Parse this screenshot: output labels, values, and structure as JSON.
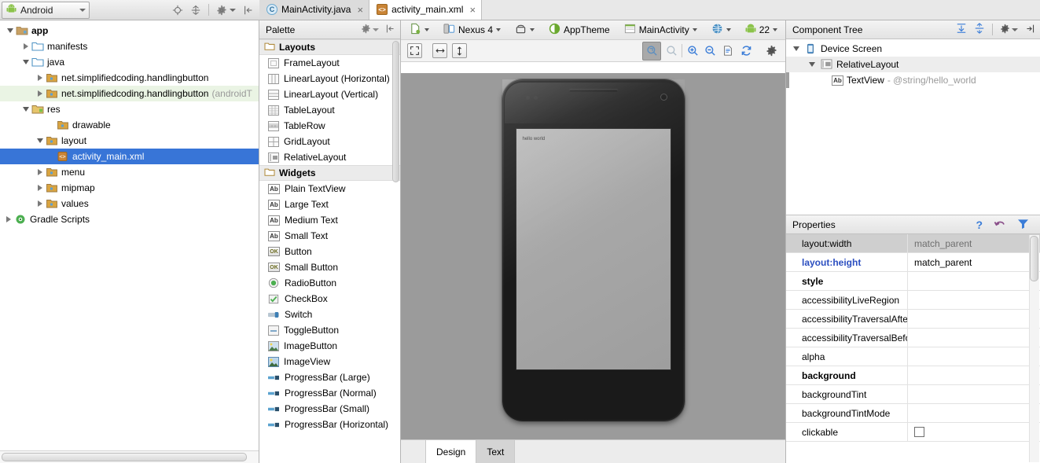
{
  "window": {
    "project_selector": {
      "label": "Android",
      "icon": "android-robot-icon"
    }
  },
  "project_toolbar": {
    "icons": [
      {
        "name": "locate-icon",
        "label": "Select Opened File"
      },
      {
        "name": "collapse-all-icon",
        "label": "Collapse All"
      },
      {
        "name": "settings-gear-icon",
        "label": "Settings"
      },
      {
        "name": "hide-panel-icon",
        "label": "Hide"
      }
    ]
  },
  "editor_tabs": [
    {
      "label": "MainActivity.java",
      "icon": "java-class-icon",
      "icon_letter": "C",
      "active": false,
      "close": "×"
    },
    {
      "label": "activity_main.xml",
      "icon": "xml-layout-icon",
      "icon_letter": "<>",
      "active": true,
      "close": "×"
    }
  ],
  "project_tree": {
    "items": [
      {
        "label": "app",
        "indent": 0,
        "state": "open",
        "icon": "module-folder-icon",
        "bold": true,
        "selected": false,
        "highlight": false,
        "sub": ""
      },
      {
        "label": "manifests",
        "indent": 1,
        "state": "closed",
        "icon": "folder-icon",
        "bold": false,
        "selected": false,
        "highlight": false,
        "sub": ""
      },
      {
        "label": "java",
        "indent": 1,
        "state": "open",
        "icon": "folder-icon",
        "bold": false,
        "selected": false,
        "highlight": false,
        "sub": ""
      },
      {
        "label": "net.simplifiedcoding.handlingbutton",
        "indent": 2,
        "state": "closed",
        "icon": "package-icon",
        "bold": false,
        "selected": false,
        "highlight": false,
        "sub": ""
      },
      {
        "label": "net.simplifiedcoding.handlingbutton",
        "indent": 2,
        "state": "closed",
        "icon": "package-icon",
        "bold": false,
        "selected": false,
        "highlight": true,
        "sub": "(androidT"
      },
      {
        "label": "res",
        "indent": 1,
        "state": "open",
        "icon": "res-folder-icon",
        "bold": false,
        "selected": false,
        "highlight": false,
        "sub": ""
      },
      {
        "label": "drawable",
        "indent": 2,
        "state": "none",
        "icon": "res-sub-folder-icon",
        "bold": false,
        "selected": false,
        "highlight": false,
        "sub": ""
      },
      {
        "label": "layout",
        "indent": 2,
        "state": "open",
        "icon": "res-sub-folder-icon",
        "bold": false,
        "selected": false,
        "highlight": false,
        "sub": ""
      },
      {
        "label": "activity_main.xml",
        "indent": 3,
        "state": "none",
        "icon": "xml-layout-icon",
        "bold": false,
        "selected": true,
        "highlight": false,
        "sub": ""
      },
      {
        "label": "menu",
        "indent": 2,
        "state": "closed",
        "icon": "res-sub-folder-icon",
        "bold": false,
        "selected": false,
        "highlight": false,
        "sub": ""
      },
      {
        "label": "mipmap",
        "indent": 2,
        "state": "closed",
        "icon": "res-sub-folder-icon",
        "bold": false,
        "selected": false,
        "highlight": false,
        "sub": ""
      },
      {
        "label": "values",
        "indent": 2,
        "state": "closed",
        "icon": "res-sub-folder-icon",
        "bold": false,
        "selected": false,
        "highlight": false,
        "sub": ""
      },
      {
        "label": "Gradle Scripts",
        "indent": 0,
        "state": "closed",
        "icon": "gradle-icon",
        "bold": false,
        "selected": false,
        "highlight": false,
        "sub": ""
      }
    ]
  },
  "palette": {
    "title": "Palette",
    "groups": [
      {
        "name": "Layouts",
        "items": [
          {
            "label": "FrameLayout",
            "icon": "frame-layout-icon"
          },
          {
            "label": "LinearLayout (Horizontal)",
            "icon": "linear-horizontal-icon"
          },
          {
            "label": "LinearLayout (Vertical)",
            "icon": "linear-vertical-icon"
          },
          {
            "label": "TableLayout",
            "icon": "table-layout-icon"
          },
          {
            "label": "TableRow",
            "icon": "table-row-icon"
          },
          {
            "label": "GridLayout",
            "icon": "grid-layout-icon"
          },
          {
            "label": "RelativeLayout",
            "icon": "relative-layout-icon"
          }
        ]
      },
      {
        "name": "Widgets",
        "items": [
          {
            "label": "Plain TextView",
            "icon": "text-ab-icon"
          },
          {
            "label": "Large Text",
            "icon": "text-ab-icon"
          },
          {
            "label": "Medium Text",
            "icon": "text-ab-icon"
          },
          {
            "label": "Small Text",
            "icon": "text-ab-icon"
          },
          {
            "label": "Button",
            "icon": "button-ok-icon"
          },
          {
            "label": "Small Button",
            "icon": "button-ok-icon"
          },
          {
            "label": "RadioButton",
            "icon": "radio-button-icon"
          },
          {
            "label": "CheckBox",
            "icon": "checkbox-icon"
          },
          {
            "label": "Switch",
            "icon": "switch-icon"
          },
          {
            "label": "ToggleButton",
            "icon": "toggle-button-icon"
          },
          {
            "label": "ImageButton",
            "icon": "image-button-icon"
          },
          {
            "label": "ImageView",
            "icon": "image-view-icon"
          },
          {
            "label": "ProgressBar (Large)",
            "icon": "progressbar-icon"
          },
          {
            "label": "ProgressBar (Normal)",
            "icon": "progressbar-icon"
          },
          {
            "label": "ProgressBar (Small)",
            "icon": "progressbar-icon"
          },
          {
            "label": "ProgressBar (Horizontal)",
            "icon": "progressbar-icon"
          }
        ]
      }
    ]
  },
  "design_toolbar": {
    "row1": [
      {
        "name": "device-config-button",
        "label": "",
        "icon": "layout-file-icon",
        "caret": true
      },
      {
        "name": "device-button",
        "label": "Nexus 4",
        "icon": "device-icon",
        "caret": true
      },
      {
        "name": "orientation-button",
        "label": "",
        "icon": "rotate-icon",
        "caret": true
      },
      {
        "name": "theme-button",
        "label": "AppTheme",
        "icon": "theme-contrast-icon",
        "caret": false
      },
      {
        "name": "activity-button",
        "label": "MainActivity",
        "icon": "activity-icon",
        "caret": true
      },
      {
        "name": "locale-button",
        "label": "",
        "icon": "globe-icon",
        "caret": true
      },
      {
        "name": "api-level-button",
        "label": "22",
        "icon": "android-robot-icon",
        "caret": true
      }
    ],
    "row2_left": [
      {
        "name": "zoom-fit-button",
        "icon": "fit-screen-icon",
        "caret": true
      },
      {
        "name": "width-constraint-button",
        "icon": "horizontal-arrows-icon",
        "caret": false
      },
      {
        "name": "height-constraint-button",
        "icon": "vertical-arrows-icon",
        "caret": false
      }
    ],
    "row2_right": [
      {
        "name": "zoom-to-fit-button",
        "icon": "zoom-fit-icon",
        "pressed": true
      },
      {
        "name": "zoom-actual-size-button",
        "icon": "zoom-1-1-icon",
        "pressed": false
      },
      {
        "name": "zoom-in-button",
        "icon": "zoom-in-icon",
        "pressed": false
      },
      {
        "name": "zoom-out-button",
        "icon": "zoom-out-icon",
        "pressed": false
      },
      {
        "name": "render-log-button",
        "icon": "document-icon",
        "pressed": false
      },
      {
        "name": "refresh-button",
        "icon": "refresh-icon",
        "pressed": false
      },
      {
        "name": "design-settings-button",
        "icon": "gear-icon",
        "pressed": false
      }
    ]
  },
  "preview": {
    "device_name": "Nexus 4",
    "screen_text": "hello world"
  },
  "editor_bottom_tabs": [
    {
      "label": "Design",
      "active": true
    },
    {
      "label": "Text",
      "active": false
    }
  ],
  "component_tree": {
    "title": "Component Tree",
    "toolbar_icons": [
      {
        "name": "expand-all-icon"
      },
      {
        "name": "collapse-all-icon"
      },
      {
        "name": "settings-gear-icon"
      },
      {
        "name": "hide-panel-icon"
      }
    ],
    "nodes": [
      {
        "label": "Device Screen",
        "sub": "",
        "indent": 0,
        "state": "open",
        "icon": "device-screen-icon",
        "highlight": false
      },
      {
        "label": "RelativeLayout",
        "sub": "",
        "indent": 1,
        "state": "open",
        "icon": "relative-layout-icon",
        "highlight": true
      },
      {
        "label": "TextView",
        "sub": "- @string/hello_world",
        "indent": 2,
        "state": "none",
        "icon": "text-ab-icon",
        "highlight": false
      }
    ]
  },
  "properties": {
    "title": "Properties",
    "toolbar_icons": [
      {
        "name": "help-icon",
        "glyph": "?"
      },
      {
        "name": "revert-icon",
        "glyph": "↶"
      },
      {
        "name": "filter-icon",
        "glyph": "▼"
      }
    ],
    "rows": [
      {
        "name": "layout:width",
        "value": "match_parent",
        "style": "selected"
      },
      {
        "name": "layout:height",
        "value": "match_parent",
        "style": "blue-bold"
      },
      {
        "name": "style",
        "value": "",
        "style": "bold"
      },
      {
        "name": "accessibilityLiveRegion",
        "value": "",
        "style": "normal"
      },
      {
        "name": "accessibilityTraversalAfte",
        "value": "",
        "style": "normal"
      },
      {
        "name": "accessibilityTraversalBefo",
        "value": "",
        "style": "normal"
      },
      {
        "name": "alpha",
        "value": "",
        "style": "normal"
      },
      {
        "name": "background",
        "value": "",
        "style": "bold"
      },
      {
        "name": "backgroundTint",
        "value": "",
        "style": "normal"
      },
      {
        "name": "backgroundTintMode",
        "value": "",
        "style": "normal"
      },
      {
        "name": "clickable",
        "value": "",
        "style": "normal",
        "control": "checkbox"
      }
    ]
  },
  "colors": {
    "selection_blue": "#3875d7",
    "accent_blue": "#2b4ec0",
    "android_green": "#8bc34a",
    "panel_bg": "#f0f0f0",
    "canvas_bg": "#9b9b9b"
  }
}
